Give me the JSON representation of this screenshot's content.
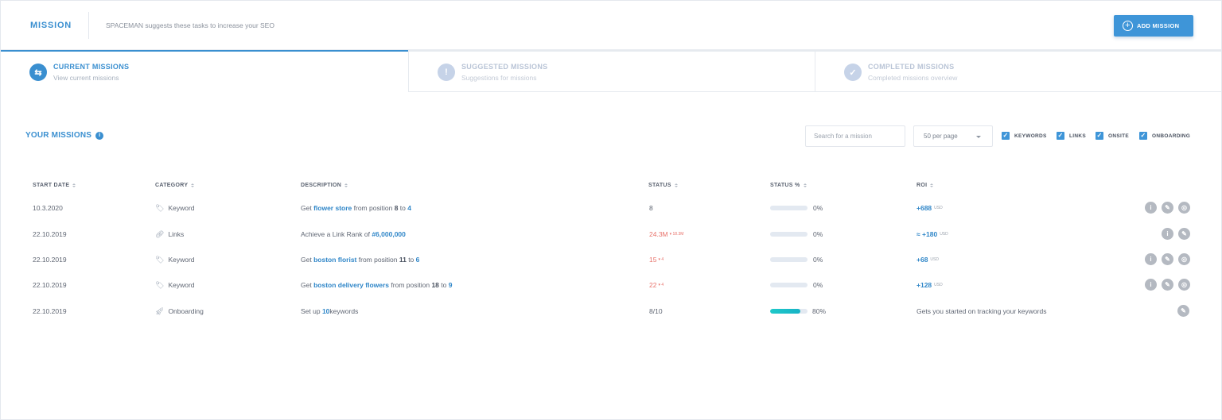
{
  "header": {
    "title": "MISSION",
    "subtitle": "SPACEMAN suggests these tasks to increase your SEO",
    "add_button": "ADD MISSION"
  },
  "tabs": [
    {
      "title": "CURRENT MISSIONS",
      "subtitle": "View current missions",
      "icon": "refresh-icon",
      "active": true
    },
    {
      "title": "SUGGESTED MISSIONS",
      "subtitle": "Suggestions for missions",
      "icon": "exclamation-icon",
      "active": false
    },
    {
      "title": "COMPLETED MISSIONS",
      "subtitle": "Completed missions overview",
      "icon": "check-icon",
      "active": false
    }
  ],
  "toolbar": {
    "heading": "YOUR MISSIONS",
    "search_placeholder": "Search for a mission",
    "per_page": "50 per page",
    "filters": [
      {
        "label": "KEYWORDS",
        "checked": true
      },
      {
        "label": "LINKS",
        "checked": true
      },
      {
        "label": "ONSITE",
        "checked": true
      },
      {
        "label": "ONBOARDING",
        "checked": true
      }
    ]
  },
  "columns": [
    "START DATE",
    "CATEGORY",
    "DESCRIPTION",
    "STATUS",
    "STATUS %",
    "ROI"
  ],
  "rows": [
    {
      "date": "10.3.2020",
      "category": "Keyword",
      "category_icon": "tag-icon",
      "desc": {
        "pre": "Get ",
        "kw": "flower store",
        "mid": " from position ",
        "a": "8",
        "to": " to ",
        "b": "4"
      },
      "status": "8",
      "status_delta": "",
      "percent": "0%",
      "progress": 0,
      "roi": "+688",
      "roi_unit": "USD",
      "actions": [
        "info",
        "edit",
        "target"
      ]
    },
    {
      "date": "22.10.2019",
      "category": "Links",
      "category_icon": "link-icon",
      "desc": {
        "pre": "Achieve a Link Rank of ",
        "kw": "#6,000,000"
      },
      "status": "24.3M",
      "status_delta": "▾ 18.3M",
      "percent": "0%",
      "progress": 0,
      "roi": "≈ +180",
      "roi_unit": "USD",
      "actions": [
        "info",
        "edit"
      ]
    },
    {
      "date": "22.10.2019",
      "category": "Keyword",
      "category_icon": "tag-icon",
      "desc": {
        "pre": "Get ",
        "kw": "boston florist",
        "mid": " from position ",
        "a": "11",
        "to": " to ",
        "b": "6"
      },
      "status": "15",
      "status_delta": "▾ 4",
      "percent": "0%",
      "progress": 0,
      "roi": "+68",
      "roi_unit": "USD",
      "actions": [
        "info",
        "edit",
        "target"
      ]
    },
    {
      "date": "22.10.2019",
      "category": "Keyword",
      "category_icon": "tag-icon",
      "desc": {
        "pre": "Get ",
        "kw": "boston delivery flowers",
        "mid": " from position ",
        "a": "18",
        "to": " to ",
        "b": "9"
      },
      "status": "22",
      "status_delta": "▾ 4",
      "percent": "0%",
      "progress": 0,
      "roi": "+128",
      "roi_unit": "USD",
      "actions": [
        "info",
        "edit",
        "target"
      ]
    },
    {
      "date": "22.10.2019",
      "category": "Onboarding",
      "category_icon": "rocket-icon",
      "desc": {
        "pre": "Set up ",
        "kw": "10",
        "mid": " keywords"
      },
      "status": "8/10",
      "status_delta": "",
      "percent": "80%",
      "progress": 0.8,
      "roi_text": "Gets you started on tracking your keywords",
      "actions": [
        "edit"
      ]
    }
  ]
}
